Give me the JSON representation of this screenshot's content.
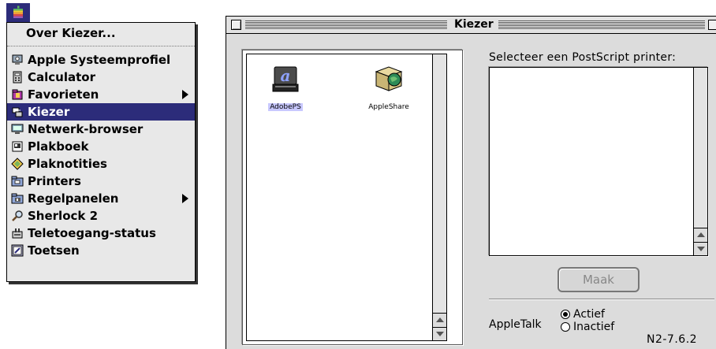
{
  "apple_menu": {
    "items": [
      {
        "label": "Over Kiezer...",
        "icon": "none"
      },
      {
        "label": "Apple Systeemprofiel",
        "icon": "system-profiler-icon"
      },
      {
        "label": "Calculator",
        "icon": "calculator-icon"
      },
      {
        "label": "Favorieten",
        "icon": "favorites-folder-icon",
        "submenu": true
      },
      {
        "label": "Kiezer",
        "icon": "chooser-icon",
        "selected": true
      },
      {
        "label": "Netwerk-browser",
        "icon": "network-browser-icon"
      },
      {
        "label": "Plakboek",
        "icon": "scrapbook-icon"
      },
      {
        "label": "Plaknotities",
        "icon": "stickies-icon"
      },
      {
        "label": "Printers",
        "icon": "printers-folder-icon"
      },
      {
        "label": "Regelpanelen",
        "icon": "control-panels-folder-icon",
        "submenu": true
      },
      {
        "label": "Sherlock 2",
        "icon": "sherlock-icon"
      },
      {
        "label": "Teletoegang-status",
        "icon": "remote-access-icon"
      },
      {
        "label": "Toetsen",
        "icon": "key-caps-icon"
      }
    ]
  },
  "chooser": {
    "title": "Kiezer",
    "devices": [
      {
        "label": "AdobePS",
        "icon": "adobeps-printer-icon",
        "selected": true
      },
      {
        "label": "AppleShare",
        "icon": "appleshare-icon"
      }
    ],
    "select_label": "Selecteer een PostScript printer:",
    "create_button": "Maak",
    "appletalk_label": "AppleTalk",
    "appletalk_options": [
      {
        "label": "Actief",
        "checked": true
      },
      {
        "label": "Inactief",
        "checked": false
      }
    ],
    "version": "N2-7.6.2"
  },
  "colors": {
    "highlight": "#2c2c7a",
    "window_bg": "#dcdcdc"
  }
}
